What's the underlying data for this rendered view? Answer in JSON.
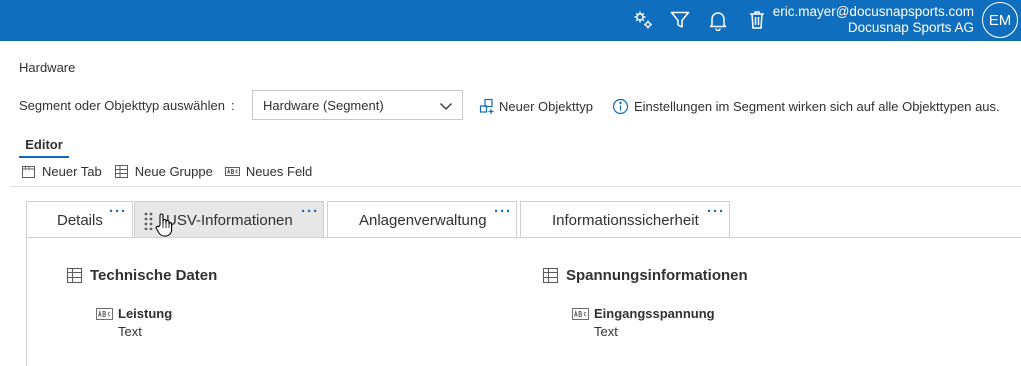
{
  "header": {
    "user_email": "eric.mayer@docusnapsports.com",
    "company": "Docusnap Sports AG",
    "avatar_initials": "EM",
    "bar_color": "#106ebe"
  },
  "breadcrumb": "Hardware",
  "segment": {
    "label": "Segment oder Objekttyp auswählen",
    "colon": ":",
    "selected": "Hardware (Segment)",
    "new_type": "Neuer Objekttyp",
    "info": "Einstellungen im Segment wirken sich auf alle Objekttypen aus."
  },
  "editor_tab": "Editor",
  "toolbar": {
    "new_tab": "Neuer Tab",
    "new_group": "Neue Gruppe",
    "new_field": "Neues Feld"
  },
  "tabs": [
    {
      "label": "Details",
      "more": "···"
    },
    {
      "label": "USV-Informationen",
      "more": "···"
    },
    {
      "label": "Anlagenverwaltung",
      "more": "···"
    },
    {
      "label": "Informationssicherheit",
      "more": "···"
    }
  ],
  "groups": [
    {
      "title": "Technische Daten",
      "fields": [
        {
          "name": "Leistung",
          "type": "Text"
        }
      ]
    },
    {
      "title": "Spannungsinformationen",
      "fields": [
        {
          "name": "Eingangsspannung",
          "type": "Text"
        }
      ]
    }
  ],
  "colors": {
    "accent": "#0f6cbd",
    "active_tab": "#e7e7e7"
  }
}
